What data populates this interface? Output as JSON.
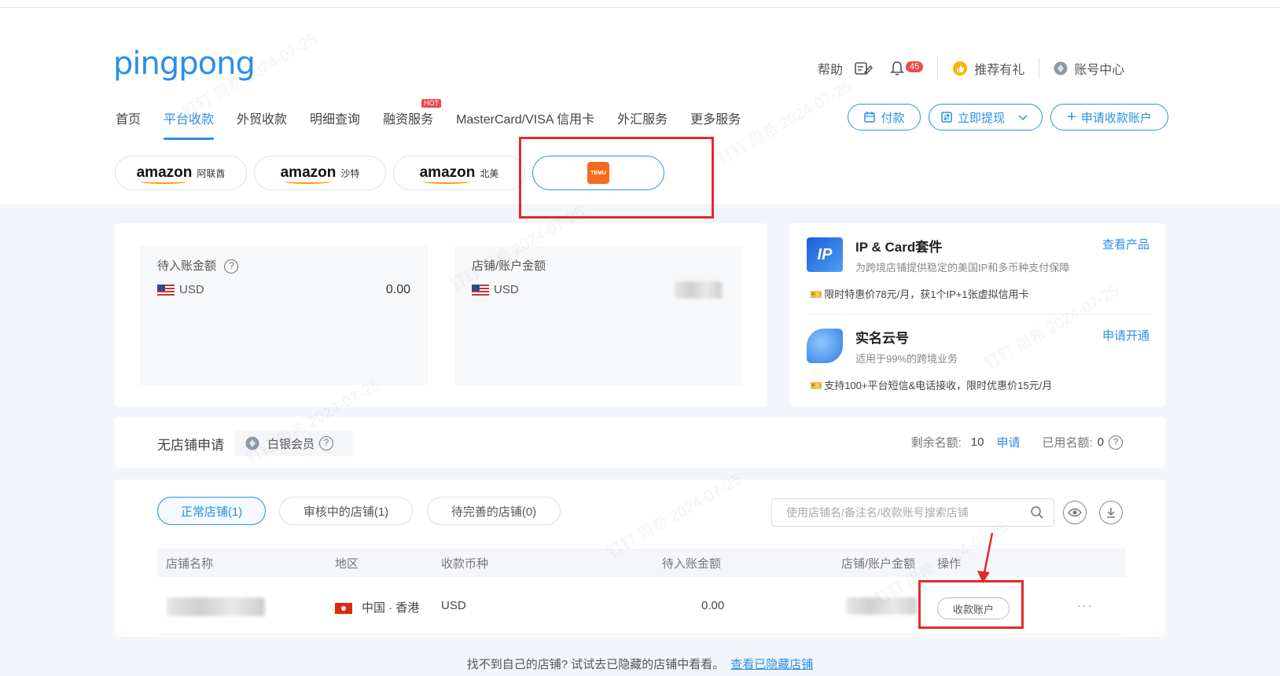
{
  "header": {
    "logo": "pingpong",
    "help": "帮助",
    "notification_count": "45",
    "referral": "推荐有礼",
    "account_center": "账号中心",
    "nav": [
      {
        "label": "首页",
        "active": false
      },
      {
        "label": "平台收款",
        "active": true
      },
      {
        "label": "外贸收款",
        "active": false
      },
      {
        "label": "明细查询",
        "active": false
      },
      {
        "label": "融资服务",
        "active": false,
        "badge": "HOT"
      },
      {
        "label": "MasterCard/VISA 信用卡",
        "active": false
      },
      {
        "label": "外汇服务",
        "active": false
      },
      {
        "label": "更多服务",
        "active": false
      }
    ],
    "buttons": {
      "pay": "付款",
      "withdraw": "立即提现",
      "apply": "申请收款账户"
    }
  },
  "stores": [
    {
      "brand": "amazon",
      "region": "阿联酋"
    },
    {
      "brand": "amazon",
      "region": "沙特"
    },
    {
      "brand": "amazon",
      "region": "北美"
    },
    {
      "brand": "TEMU",
      "region": ""
    }
  ],
  "balance": {
    "pending": {
      "label": "待入账金额",
      "currency": "USD",
      "amount": "0.00"
    },
    "store": {
      "label": "店铺/账户金额",
      "currency": "USD"
    }
  },
  "products": [
    {
      "title": "IP & Card套件",
      "subtitle": "为跨境店铺提供稳定的美国IP和多币种支付保障",
      "action": "查看产品",
      "promo": "限时特惠价78元/月，获1个IP+1张虚拟信用卡"
    },
    {
      "title": "实名云号",
      "subtitle": "适用于99%的跨境业务",
      "action": "申请开通",
      "promo": "支持100+平台短信&电话接收，限时优惠价15元/月"
    }
  ],
  "nostore": {
    "label": "无店铺申请",
    "member": "白银会员",
    "remaining_label": "剩余名额:",
    "remaining": "10",
    "apply": "申请",
    "used_label": "已用名额:",
    "used": "0"
  },
  "tabs": [
    {
      "label": "正常店铺(1)",
      "active": true
    },
    {
      "label": "审核中的店铺(1)",
      "active": false
    },
    {
      "label": "待完善的店铺(0)",
      "active": false
    }
  ],
  "search": {
    "placeholder": "使用店铺名/备注名/收款账号搜索店铺"
  },
  "table": {
    "columns": [
      "店铺名称",
      "地区",
      "收款币种",
      "待入账金额",
      "店铺/账户金额",
      "操作"
    ],
    "rows": [
      {
        "region": "中国 · 香港",
        "currency": "USD",
        "pending": "0.00",
        "action": "收款账户",
        "more": "···"
      }
    ]
  },
  "footer": {
    "text": "找不到自己的店铺? 试试去已隐藏的店铺中看看。",
    "link": "查看已隐藏店铺"
  },
  "watermark": "钉钉 周希 2024-07-25",
  "colors": {
    "accent": "#2b8fe6",
    "highlight": "#e22a2a",
    "temu": "#f56d1b"
  }
}
